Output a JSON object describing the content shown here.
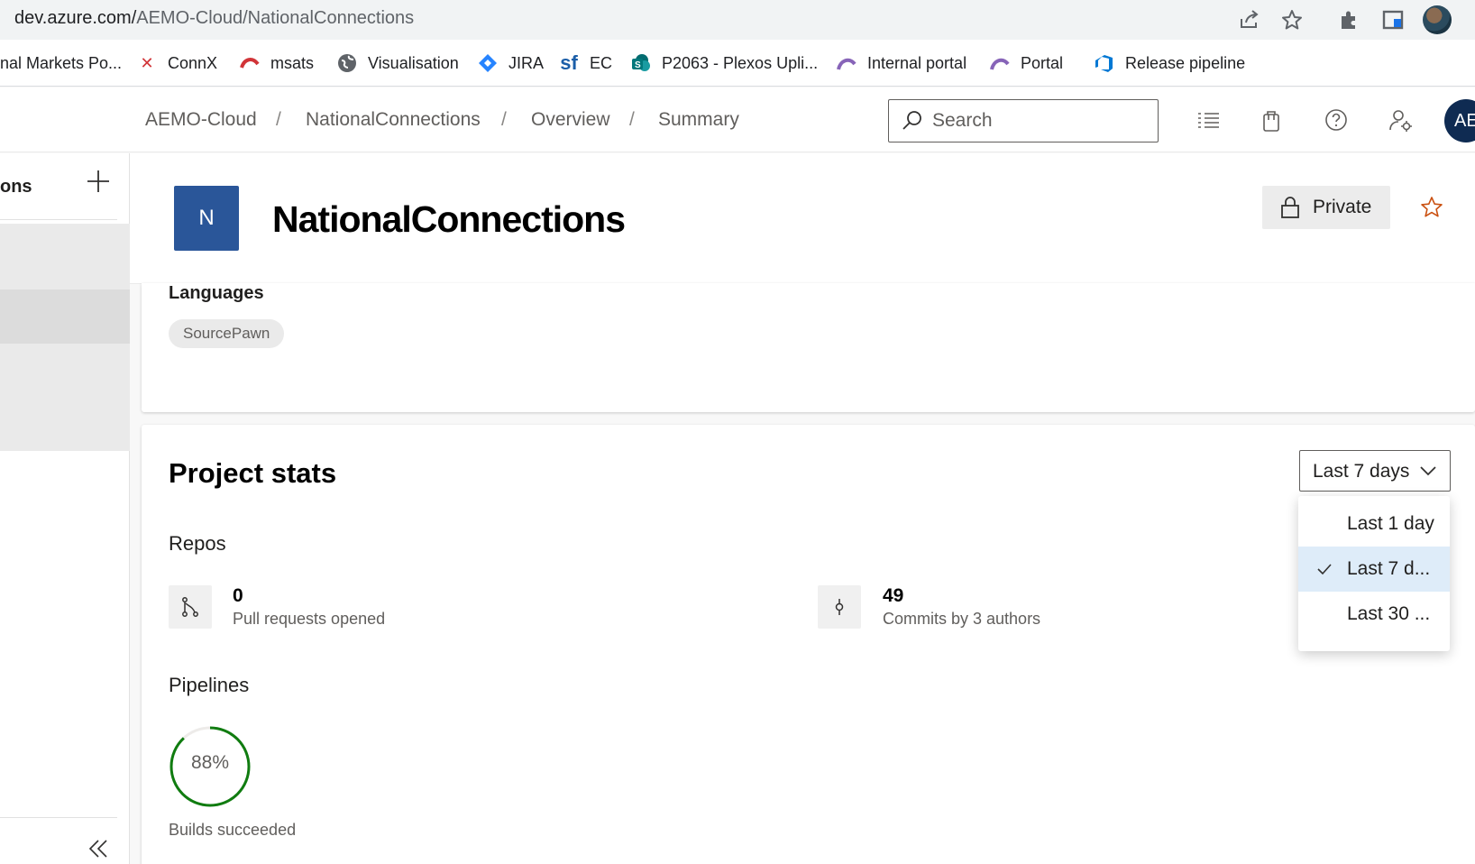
{
  "browser": {
    "url_host": "dev.azure.com/",
    "url_path": "AEMO-Cloud/NationalConnections",
    "bookmarks": [
      {
        "label": "nal Markets Po..."
      },
      {
        "label": "ConnX"
      },
      {
        "label": "msats"
      },
      {
        "label": "Visualisation"
      },
      {
        "label": "JIRA"
      },
      {
        "label": "EC"
      },
      {
        "label": "P2063 - Plexos Upli..."
      },
      {
        "label": "Internal portal"
      },
      {
        "label": "Portal"
      },
      {
        "label": "Release pipeline"
      }
    ]
  },
  "header": {
    "breadcrumbs": [
      "AEMO-Cloud",
      "NationalConnections",
      "Overview",
      "Summary"
    ],
    "separator": "/",
    "search_placeholder": "Search",
    "user_initials": "AE"
  },
  "sidebar": {
    "title_fragment": "ons"
  },
  "project": {
    "logo_letter": "N",
    "name": "NationalConnections",
    "visibility_label": "Private"
  },
  "about": {
    "languages_title": "Languages",
    "languages": [
      "SourcePawn"
    ]
  },
  "stats": {
    "title": "Project stats",
    "range_selected": "Last 7 days",
    "range_options": [
      {
        "label": "Last 1 day",
        "selected": false
      },
      {
        "label": "Last 7 d...",
        "selected": true
      },
      {
        "label": "Last 30 ...",
        "selected": false
      }
    ],
    "repos_label": "Repos",
    "pull_requests_value": "0",
    "pull_requests_caption": "Pull requests opened",
    "commits_value": "49",
    "commits_caption": "Commits by 3 authors",
    "pipelines_label": "Pipelines",
    "builds_succeeded_percent": 88,
    "builds_succeeded_text": "88%",
    "builds_caption": "Builds succeeded"
  },
  "colors": {
    "project_logo": "#2a5699",
    "ring_success": "#107c10",
    "dropdown_selected": "#deecf9",
    "user_avatar": "#0f2b52",
    "favorite_star": "#ca5010"
  }
}
